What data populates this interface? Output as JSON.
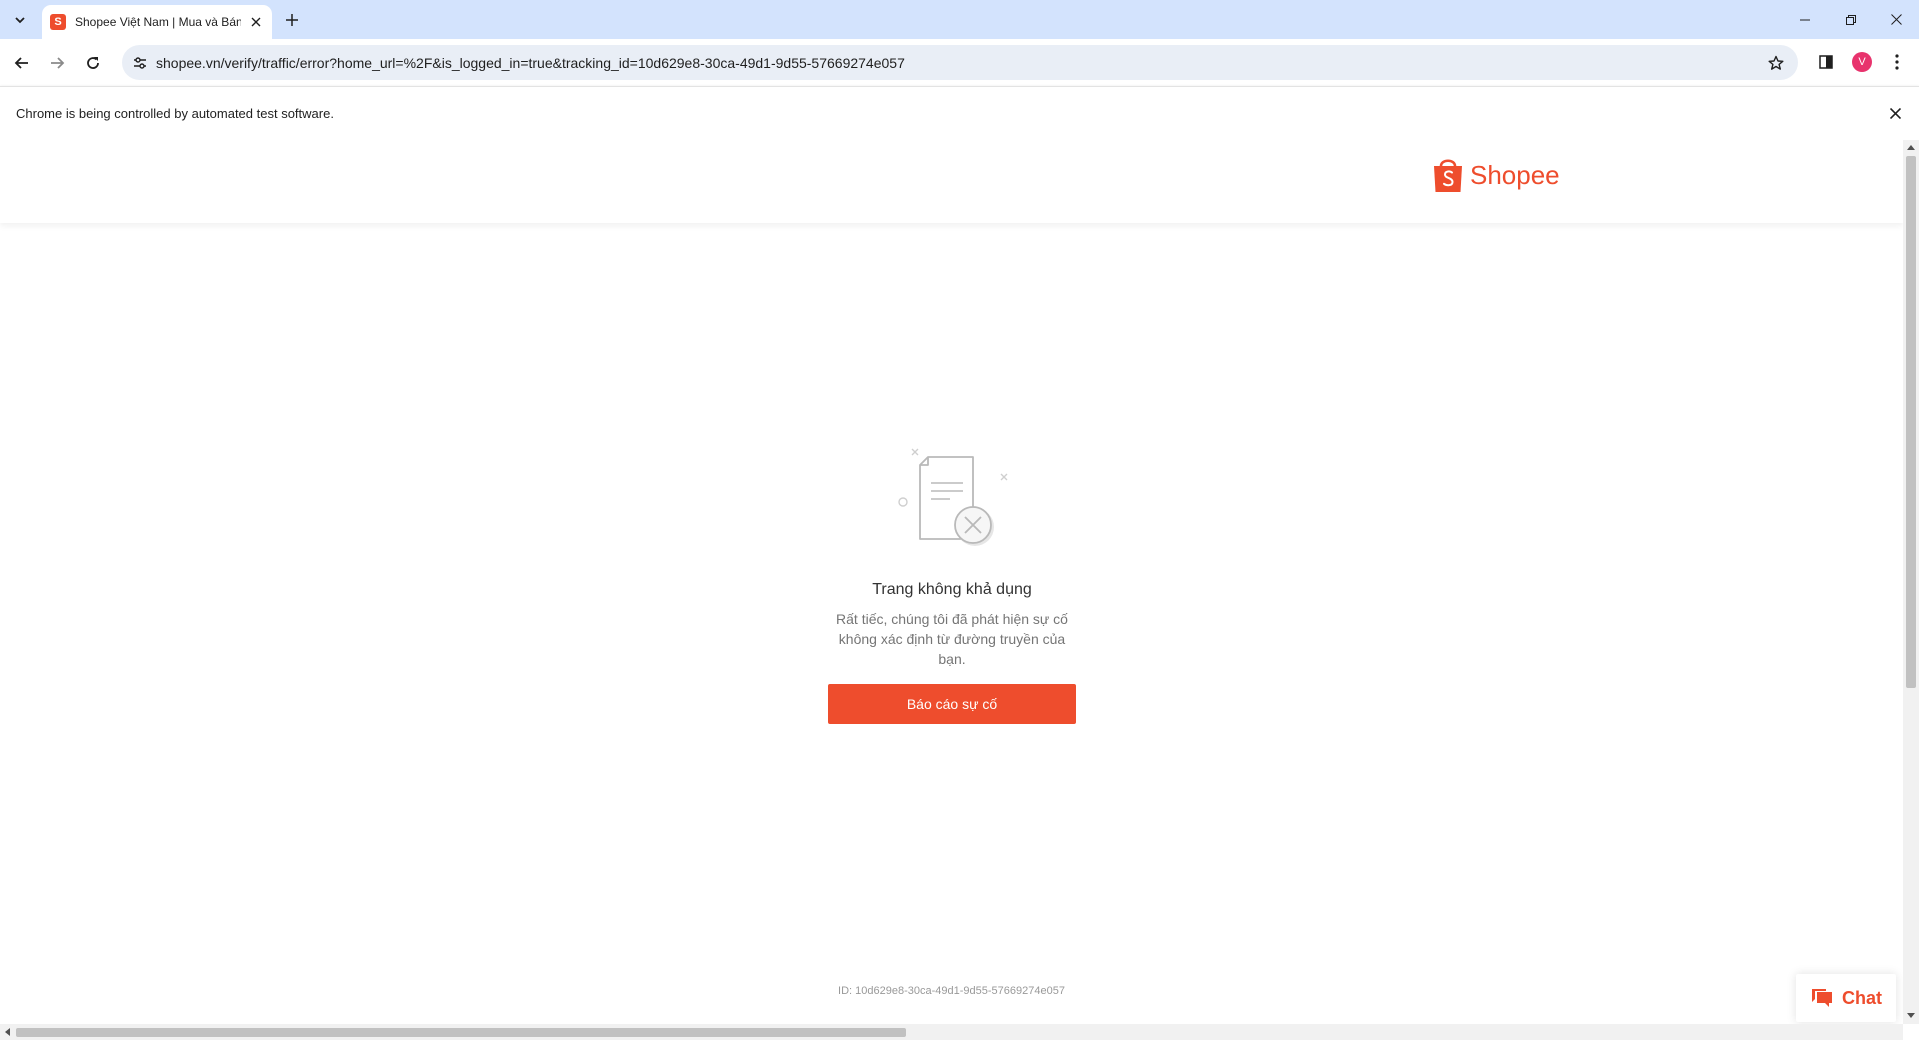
{
  "browser": {
    "tab": {
      "favicon": "S",
      "title": "Shopee Việt Nam | Mua và Bán",
      "favicon_color": "#ee4d2d"
    },
    "url": "shopee.vn/verify/traffic/error?home_url=%2F&is_logged_in=true&tracking_id=10d629e8-30ca-49d1-9d55-57669274e057",
    "profile_initial": "V",
    "icons": {
      "tab_search": "chevron-down-icon",
      "tab_close": "close-icon",
      "new_tab": "plus-icon",
      "back": "arrow-left-icon",
      "forward": "arrow-right-icon",
      "reload": "reload-icon",
      "site_info": "tune-icon",
      "bookmark": "star-icon",
      "side_panel": "side-panel-icon",
      "menu": "kebab-menu-icon"
    },
    "infobar_text": "Chrome is being controlled by automated test software."
  },
  "page": {
    "logo_text": "Shopee",
    "error_title": "Trang không khả dụng",
    "error_description": "Rất tiếc, chúng tôi đã phát hiện sự cố không xác định từ đường truyền của bạn.",
    "report_button_label": "Báo cáo sự cố",
    "tracking_id": "ID: 10d629e8-30ca-49d1-9d55-57669274e057",
    "chat_label": "Chat",
    "brand_color": "#ee4d2d"
  }
}
